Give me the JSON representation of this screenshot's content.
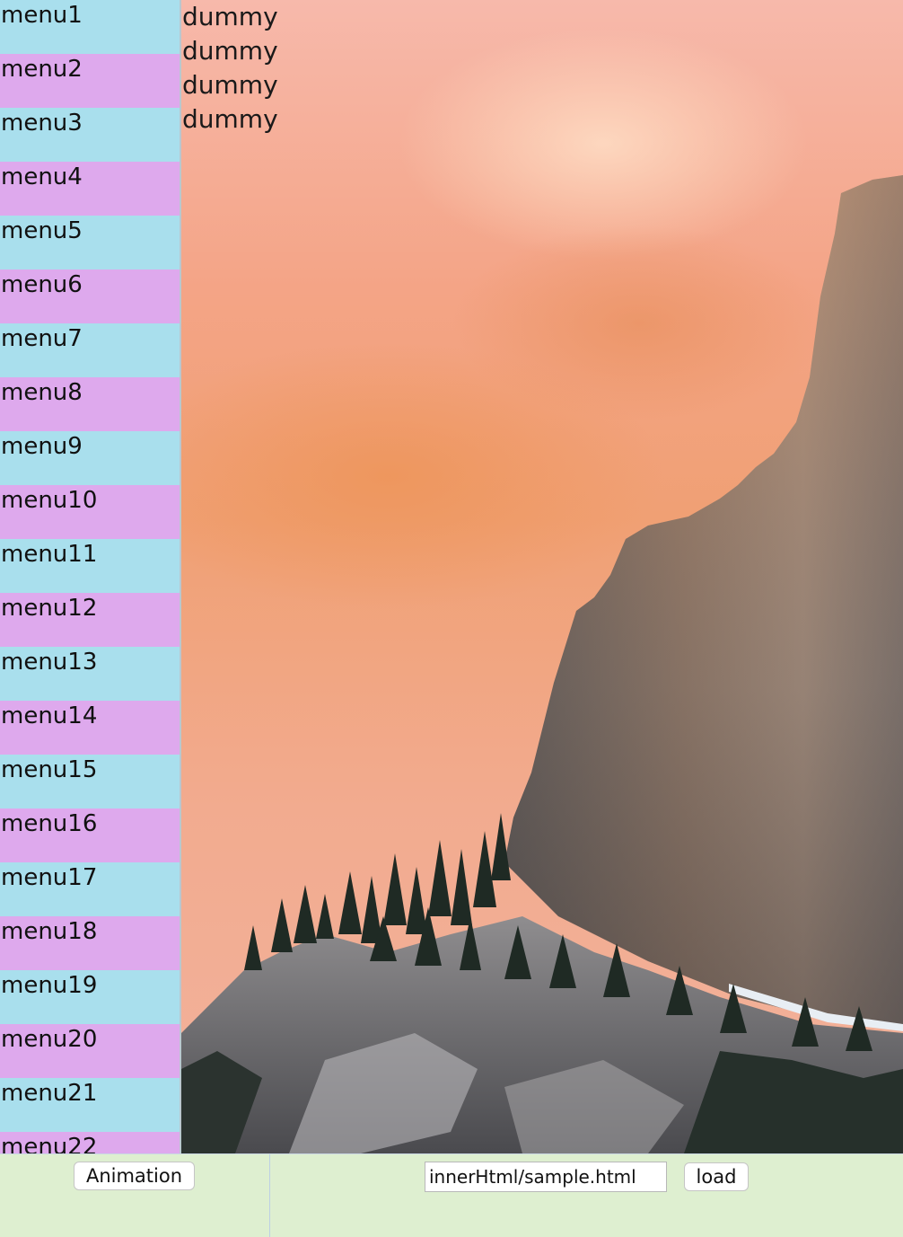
{
  "sidebar": {
    "items": [
      {
        "label": "menu1"
      },
      {
        "label": "menu2"
      },
      {
        "label": "menu3"
      },
      {
        "label": "menu4"
      },
      {
        "label": "menu5"
      },
      {
        "label": "menu6"
      },
      {
        "label": "menu7"
      },
      {
        "label": "menu8"
      },
      {
        "label": "menu9"
      },
      {
        "label": "menu10"
      },
      {
        "label": "menu11"
      },
      {
        "label": "menu12"
      },
      {
        "label": "menu13"
      },
      {
        "label": "menu14"
      },
      {
        "label": "menu15"
      },
      {
        "label": "menu16"
      },
      {
        "label": "menu17"
      },
      {
        "label": "menu18"
      },
      {
        "label": "menu19"
      },
      {
        "label": "menu20"
      },
      {
        "label": "menu21"
      },
      {
        "label": "menu22"
      }
    ],
    "colors": {
      "odd": "#a9dfed",
      "even": "#dea9ed"
    }
  },
  "content": {
    "lines": [
      "dummy",
      "dummy",
      "dummy",
      "dummy"
    ]
  },
  "toolbar": {
    "animation_label": "Animation",
    "url_value": "innerHtml/sample.html",
    "load_label": "load",
    "background": "#deefd0"
  }
}
